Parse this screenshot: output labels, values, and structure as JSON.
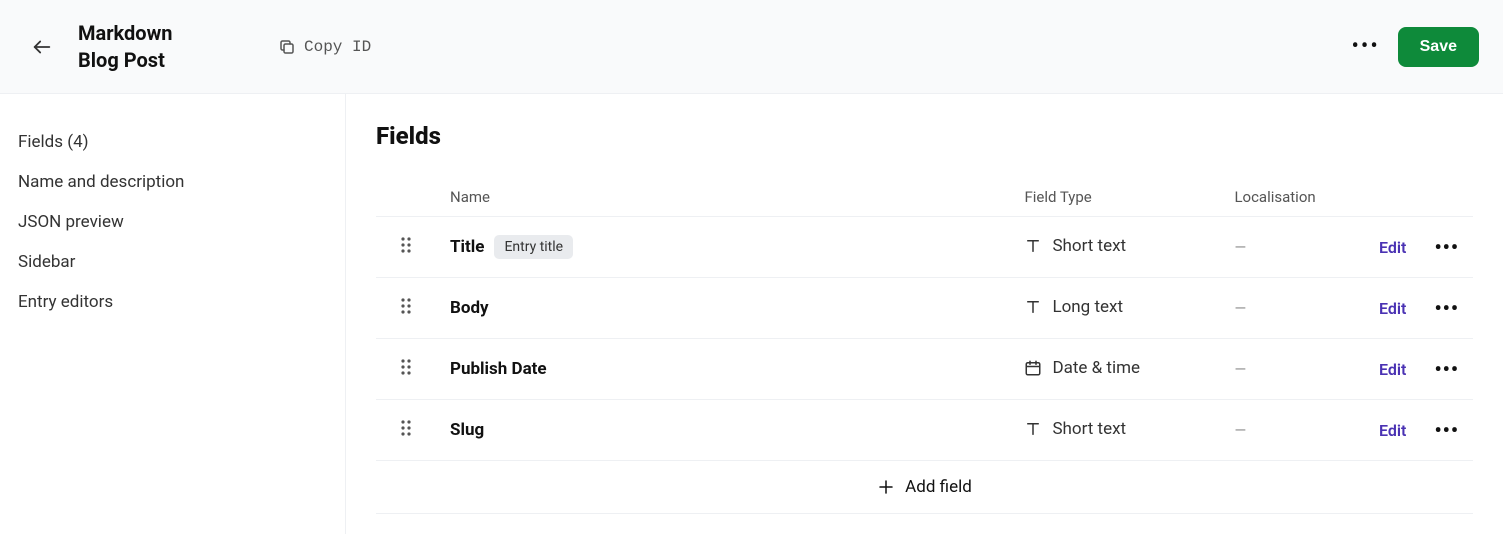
{
  "header": {
    "title": "Markdown Blog Post",
    "copy_id_label": "Copy ID",
    "save_label": "Save"
  },
  "sidebar": {
    "items": [
      {
        "label": "Fields (4)"
      },
      {
        "label": "Name and description"
      },
      {
        "label": "JSON preview"
      },
      {
        "label": "Sidebar"
      },
      {
        "label": "Entry editors"
      }
    ]
  },
  "main": {
    "heading": "Fields",
    "columns": {
      "name": "Name",
      "type": "Field Type",
      "loc": "Localisation"
    },
    "rows": [
      {
        "name": "Title",
        "badge": "Entry title",
        "type_icon": "text",
        "type_label": "Short text",
        "loc": "—",
        "edit": "Edit"
      },
      {
        "name": "Body",
        "badge": "",
        "type_icon": "text",
        "type_label": "Long text",
        "loc": "—",
        "edit": "Edit"
      },
      {
        "name": "Publish Date",
        "badge": "",
        "type_icon": "calendar",
        "type_label": "Date & time",
        "loc": "—",
        "edit": "Edit"
      },
      {
        "name": "Slug",
        "badge": "",
        "type_icon": "text",
        "type_label": "Short text",
        "loc": "—",
        "edit": "Edit"
      }
    ],
    "add_field_label": "Add field"
  }
}
